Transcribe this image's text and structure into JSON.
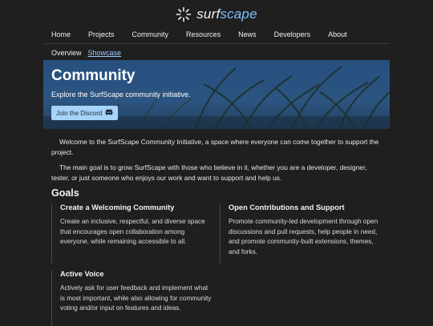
{
  "brand": {
    "name_part1": "surf",
    "name_part2": "scape",
    "logo_icon": "sun-burst-icon"
  },
  "nav": {
    "items": [
      {
        "label": "Home"
      },
      {
        "label": "Projects"
      },
      {
        "label": "Community"
      },
      {
        "label": "Resources"
      },
      {
        "label": "News"
      },
      {
        "label": "Developers"
      },
      {
        "label": "About"
      }
    ]
  },
  "subnav": {
    "items": [
      {
        "label": "Overview"
      },
      {
        "label": "Showcase"
      }
    ],
    "active": "Showcase"
  },
  "hero": {
    "title": "Community",
    "subtitle": "Explore the SurfScape community initiative.",
    "button_label": "Join the Discord",
    "button_icon": "discord-icon"
  },
  "intro": {
    "p1": "Welcome to the SurfScape Community Initiative, a space where everyone can come together to support the project.",
    "p2": "The main goal is to grow SurfScape with those who believe in it, whether you are a developer, designer, tester, or just someone who enjoys our work and want to support and help us."
  },
  "goals": {
    "heading": "Goals",
    "cards": [
      {
        "title": "Create a Welcoming Community",
        "body": "Create an inclusive, respectful, and diverse space that encourages open collaboration among everyone, while remaining accessible to all."
      },
      {
        "title": "Open Contributions and Support",
        "body": "Promote community-led development through open discussions and pull requests, help people in need, and promote community-built extensions, themes, and forks."
      },
      {
        "title": "Active Voice",
        "body": "Actively ask for user feedback and implement what is most important, while also allowing for community voting and/or input on features and ideas."
      }
    ]
  },
  "colors": {
    "background": "#1f1f1f",
    "hero_bg": "#2b4f7c",
    "accent": "#79c0ff",
    "button_bg": "#a8d3f8"
  }
}
